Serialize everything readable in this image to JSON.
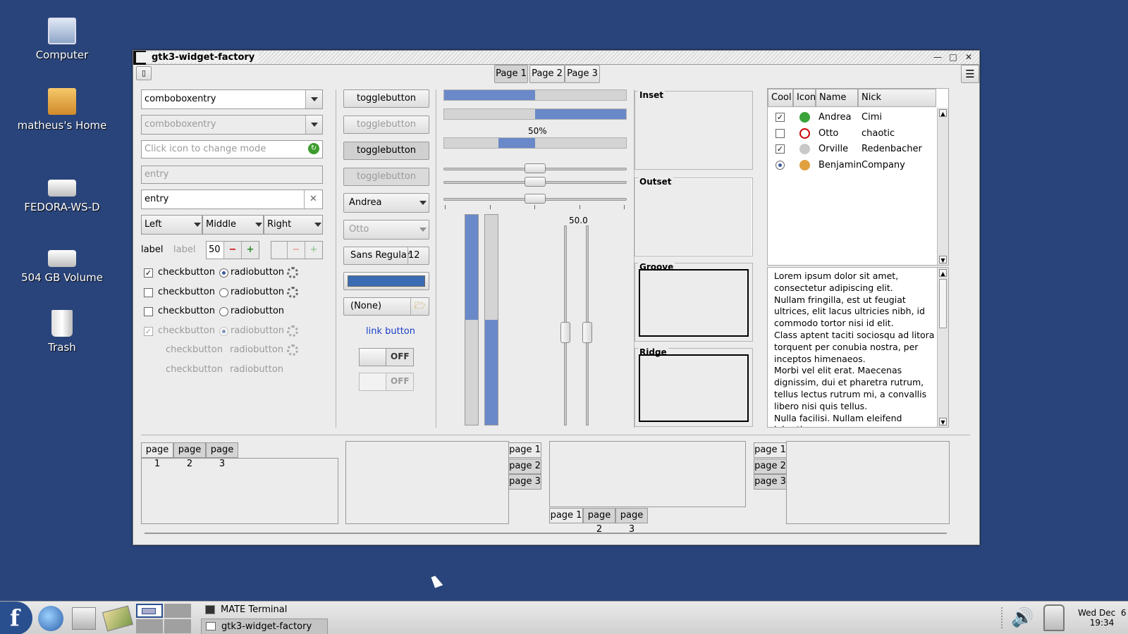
{
  "desktop": {
    "icons": [
      {
        "label": "Computer",
        "icon": "computer-icon"
      },
      {
        "label": "matheus's Home",
        "icon": "home-folder-icon"
      },
      {
        "label": "FEDORA-WS-D",
        "icon": "drive-icon"
      },
      {
        "label": "504 GB Volume",
        "icon": "drive-icon"
      },
      {
        "label": "Trash",
        "icon": "trash-icon"
      }
    ]
  },
  "window": {
    "title": "gtk3-widget-factory",
    "page_tabs": [
      "Page 1",
      "Page 2",
      "Page 3"
    ],
    "active_page_tab": 0
  },
  "col1": {
    "combo1": "comboboxentry",
    "combo2": "comboboxentry",
    "entry_mode_placeholder": "Click icon to change mode",
    "entry_disabled": "entry",
    "entry_clear": "entry",
    "combo_left": "Left",
    "combo_middle": "Middle",
    "combo_right": "Right",
    "label1": "label",
    "label2": "label",
    "spin_value": "50",
    "checks": [
      {
        "label": "checkbutton",
        "checked": true,
        "disabled": false
      },
      {
        "label": "checkbutton",
        "checked": false,
        "disabled": false
      },
      {
        "label": "checkbutton",
        "checked": false,
        "disabled": false
      },
      {
        "label": "checkbutton",
        "checked": true,
        "disabled": true
      },
      {
        "label": "checkbutton",
        "checked": false,
        "disabled": true,
        "hidden_box": true
      },
      {
        "label": "checkbutton",
        "checked": false,
        "disabled": true,
        "hidden_box": true
      }
    ],
    "radios": [
      {
        "label": "radiobutton",
        "selected": true,
        "disabled": false
      },
      {
        "label": "radiobutton",
        "selected": false,
        "disabled": false
      },
      {
        "label": "radiobutton",
        "selected": false,
        "disabled": false
      },
      {
        "label": "radiobutton",
        "selected": true,
        "disabled": true
      },
      {
        "label": "radiobutton",
        "selected": false,
        "disabled": true
      },
      {
        "label": "radiobutton",
        "selected": false,
        "disabled": true
      }
    ]
  },
  "col2": {
    "toggles": [
      "togglebutton",
      "togglebutton",
      "togglebutton",
      "togglebutton"
    ],
    "combo_andrea": "Andrea",
    "combo_otto": "Otto",
    "font_name": "Sans Regular",
    "font_size": "12",
    "color_hex": "#3b6cb3",
    "file_none": "(None)",
    "link": "link button",
    "switch1": "OFF",
    "switch2": "OFF"
  },
  "col3": {
    "progress": [
      0.5,
      0.5,
      0.5
    ],
    "progress_label": "50%",
    "hscale_values": [
      0.5,
      0.5,
      0.5
    ],
    "vprogress": [
      0.5,
      0.5
    ],
    "vscale_label": "50.0",
    "vscale_values": [
      0.5,
      0.5
    ]
  },
  "frames": [
    "Inset",
    "Outset",
    "Groove",
    "Ridge"
  ],
  "tree": {
    "columns": [
      "Cool",
      "Icon",
      "Name",
      "Nick"
    ],
    "rows": [
      {
        "cool": "check",
        "icon": "ok-icon",
        "name": "Andrea",
        "nick": "Cimi"
      },
      {
        "cool": "uncheck",
        "icon": "error-icon",
        "name": "Otto",
        "nick": "chaotic"
      },
      {
        "cool": "check",
        "icon": "grey-circle-icon",
        "name": "Orville",
        "nick": "Redenbacher"
      },
      {
        "cool": "radio",
        "icon": "face-icon",
        "name": "Benjamin",
        "nick": "Company"
      }
    ]
  },
  "textview": "Lorem ipsum dolor sit amet, consectetur adipiscing elit.\nNullam fringilla, est ut feugiat ultrices, elit lacus ultricies nibh, id commodo tortor nisi id elit.\nClass aptent taciti sociosqu ad litora torquent per conubia nostra, per inceptos himenaeos.\nMorbi vel elit erat. Maecenas dignissim, dui et pharetra rutrum, tellus lectus rutrum mi, a convallis libero nisi quis tellus.\nNulla facilisi. Nullam eleifend lobortis",
  "notebooks": {
    "tabs": [
      "page 1",
      "page 2",
      "page 3"
    ]
  },
  "taskbar": {
    "tasks": [
      "MATE Terminal",
      "gtk3-widget-factory"
    ],
    "clock_date": "Wed Dec  6",
    "clock_time": "19:34"
  }
}
